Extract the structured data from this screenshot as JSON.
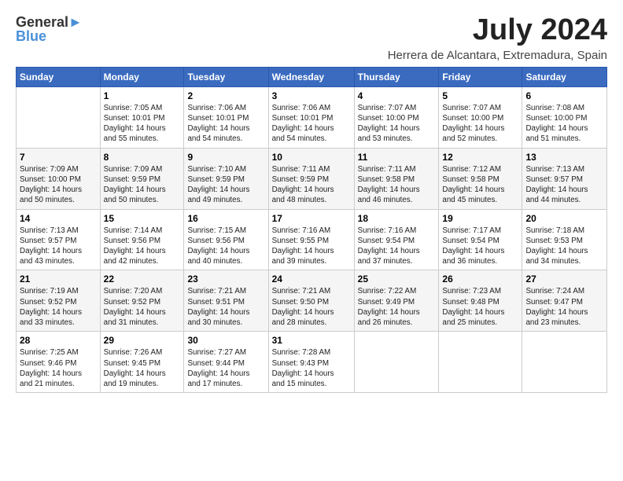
{
  "logo": {
    "line1": "General",
    "line2": "Blue"
  },
  "title": "July 2024",
  "subtitle": "Herrera de Alcantara, Extremadura, Spain",
  "days_of_week": [
    "Sunday",
    "Monday",
    "Tuesday",
    "Wednesday",
    "Thursday",
    "Friday",
    "Saturday"
  ],
  "weeks": [
    [
      {
        "day": "",
        "info": ""
      },
      {
        "day": "1",
        "info": "Sunrise: 7:05 AM\nSunset: 10:01 PM\nDaylight: 14 hours\nand 55 minutes."
      },
      {
        "day": "2",
        "info": "Sunrise: 7:06 AM\nSunset: 10:01 PM\nDaylight: 14 hours\nand 54 minutes."
      },
      {
        "day": "3",
        "info": "Sunrise: 7:06 AM\nSunset: 10:01 PM\nDaylight: 14 hours\nand 54 minutes."
      },
      {
        "day": "4",
        "info": "Sunrise: 7:07 AM\nSunset: 10:00 PM\nDaylight: 14 hours\nand 53 minutes."
      },
      {
        "day": "5",
        "info": "Sunrise: 7:07 AM\nSunset: 10:00 PM\nDaylight: 14 hours\nand 52 minutes."
      },
      {
        "day": "6",
        "info": "Sunrise: 7:08 AM\nSunset: 10:00 PM\nDaylight: 14 hours\nand 51 minutes."
      }
    ],
    [
      {
        "day": "7",
        "info": "Sunrise: 7:09 AM\nSunset: 10:00 PM\nDaylight: 14 hours\nand 50 minutes."
      },
      {
        "day": "8",
        "info": "Sunrise: 7:09 AM\nSunset: 9:59 PM\nDaylight: 14 hours\nand 50 minutes."
      },
      {
        "day": "9",
        "info": "Sunrise: 7:10 AM\nSunset: 9:59 PM\nDaylight: 14 hours\nand 49 minutes."
      },
      {
        "day": "10",
        "info": "Sunrise: 7:11 AM\nSunset: 9:59 PM\nDaylight: 14 hours\nand 48 minutes."
      },
      {
        "day": "11",
        "info": "Sunrise: 7:11 AM\nSunset: 9:58 PM\nDaylight: 14 hours\nand 46 minutes."
      },
      {
        "day": "12",
        "info": "Sunrise: 7:12 AM\nSunset: 9:58 PM\nDaylight: 14 hours\nand 45 minutes."
      },
      {
        "day": "13",
        "info": "Sunrise: 7:13 AM\nSunset: 9:57 PM\nDaylight: 14 hours\nand 44 minutes."
      }
    ],
    [
      {
        "day": "14",
        "info": "Sunrise: 7:13 AM\nSunset: 9:57 PM\nDaylight: 14 hours\nand 43 minutes."
      },
      {
        "day": "15",
        "info": "Sunrise: 7:14 AM\nSunset: 9:56 PM\nDaylight: 14 hours\nand 42 minutes."
      },
      {
        "day": "16",
        "info": "Sunrise: 7:15 AM\nSunset: 9:56 PM\nDaylight: 14 hours\nand 40 minutes."
      },
      {
        "day": "17",
        "info": "Sunrise: 7:16 AM\nSunset: 9:55 PM\nDaylight: 14 hours\nand 39 minutes."
      },
      {
        "day": "18",
        "info": "Sunrise: 7:16 AM\nSunset: 9:54 PM\nDaylight: 14 hours\nand 37 minutes."
      },
      {
        "day": "19",
        "info": "Sunrise: 7:17 AM\nSunset: 9:54 PM\nDaylight: 14 hours\nand 36 minutes."
      },
      {
        "day": "20",
        "info": "Sunrise: 7:18 AM\nSunset: 9:53 PM\nDaylight: 14 hours\nand 34 minutes."
      }
    ],
    [
      {
        "day": "21",
        "info": "Sunrise: 7:19 AM\nSunset: 9:52 PM\nDaylight: 14 hours\nand 33 minutes."
      },
      {
        "day": "22",
        "info": "Sunrise: 7:20 AM\nSunset: 9:52 PM\nDaylight: 14 hours\nand 31 minutes."
      },
      {
        "day": "23",
        "info": "Sunrise: 7:21 AM\nSunset: 9:51 PM\nDaylight: 14 hours\nand 30 minutes."
      },
      {
        "day": "24",
        "info": "Sunrise: 7:21 AM\nSunset: 9:50 PM\nDaylight: 14 hours\nand 28 minutes."
      },
      {
        "day": "25",
        "info": "Sunrise: 7:22 AM\nSunset: 9:49 PM\nDaylight: 14 hours\nand 26 minutes."
      },
      {
        "day": "26",
        "info": "Sunrise: 7:23 AM\nSunset: 9:48 PM\nDaylight: 14 hours\nand 25 minutes."
      },
      {
        "day": "27",
        "info": "Sunrise: 7:24 AM\nSunset: 9:47 PM\nDaylight: 14 hours\nand 23 minutes."
      }
    ],
    [
      {
        "day": "28",
        "info": "Sunrise: 7:25 AM\nSunset: 9:46 PM\nDaylight: 14 hours\nand 21 minutes."
      },
      {
        "day": "29",
        "info": "Sunrise: 7:26 AM\nSunset: 9:45 PM\nDaylight: 14 hours\nand 19 minutes."
      },
      {
        "day": "30",
        "info": "Sunrise: 7:27 AM\nSunset: 9:44 PM\nDaylight: 14 hours\nand 17 minutes."
      },
      {
        "day": "31",
        "info": "Sunrise: 7:28 AM\nSunset: 9:43 PM\nDaylight: 14 hours\nand 15 minutes."
      },
      {
        "day": "",
        "info": ""
      },
      {
        "day": "",
        "info": ""
      },
      {
        "day": "",
        "info": ""
      }
    ]
  ]
}
